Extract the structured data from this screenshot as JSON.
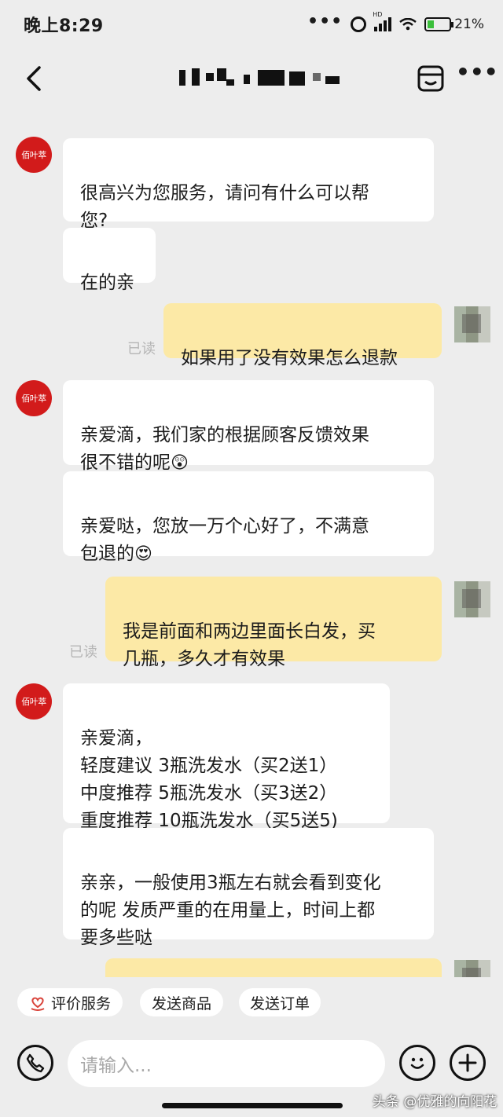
{
  "status_bar": {
    "time": "晚上8:29",
    "more": "•••",
    "network": "HD",
    "battery": "21%"
  },
  "chat": {
    "shop_avatar_text": "佰叶萃",
    "messages": [
      {
        "side": "in",
        "text": "很高兴为您服务，请问有什么可以帮\n您?"
      },
      {
        "side": "in",
        "text": "在的亲"
      },
      {
        "side": "out",
        "text": "如果用了没有效果怎么退款",
        "status": "已读"
      },
      {
        "side": "in",
        "text": "亲爱滴，我们家的根据顾客反馈效果\n很不错的呢",
        "emoji": "😲"
      },
      {
        "side": "in",
        "text": "亲爱哒，您放一万个心好了，不满意\n包退的",
        "emoji": "😍"
      },
      {
        "side": "out",
        "text": "我是前面和两边里面长白发，买\n几瓶，多久才有效果",
        "status": "已读"
      },
      {
        "side": "in",
        "text": "亲爱滴，\n轻度建议  3瓶洗发水（买2送1）\n中度推荐  5瓶洗发水（买3送2）\n重度推荐 10瓶洗发水（买5送5)"
      },
      {
        "side": "in",
        "text": "亲亲，一般使用3瓶左右就会看到变化\n的呢 发质严重的在用量上，时间上都\n要多些哒"
      }
    ]
  },
  "quick_actions": [
    {
      "label": "评价服务",
      "icon": "heart-hand-icon"
    },
    {
      "label": "发送商品"
    },
    {
      "label": "发送订单"
    }
  ],
  "input": {
    "placeholder": "请输入..."
  },
  "watermark": "头条 @优雅的向阳花",
  "colors": {
    "background": "#ededed",
    "bubble_in": "#ffffff",
    "bubble_out": "#fce9a6",
    "shop_avatar": "#d21b1b"
  }
}
